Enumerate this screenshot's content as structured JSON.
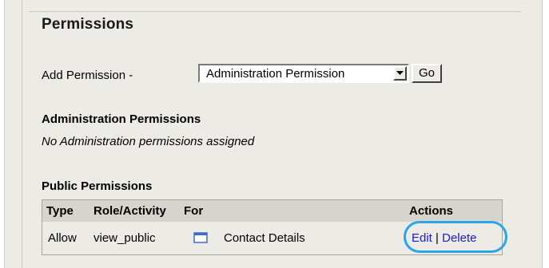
{
  "section": {
    "title": "Permissions"
  },
  "add_permission": {
    "label": "Add Permission -",
    "selected": "Administration Permission",
    "go_label": "Go"
  },
  "admin": {
    "title": "Administration Permissions",
    "note": "No Administration permissions assigned"
  },
  "public": {
    "title": "Public Permissions",
    "headers": {
      "type": "Type",
      "role": "Role/Activity",
      "for": "For",
      "actions": "Actions"
    },
    "rows": [
      {
        "type": "Allow",
        "role": "view_public",
        "icon": "window-icon",
        "for": "Contact Details",
        "edit": "Edit",
        "sep": "|",
        "delete": "Delete"
      }
    ]
  },
  "colors": {
    "panel_bg": "#ecebe6",
    "header_bg": "#d6d4cc",
    "link": "#1a1ad8",
    "highlight": "#2aa4ea"
  }
}
